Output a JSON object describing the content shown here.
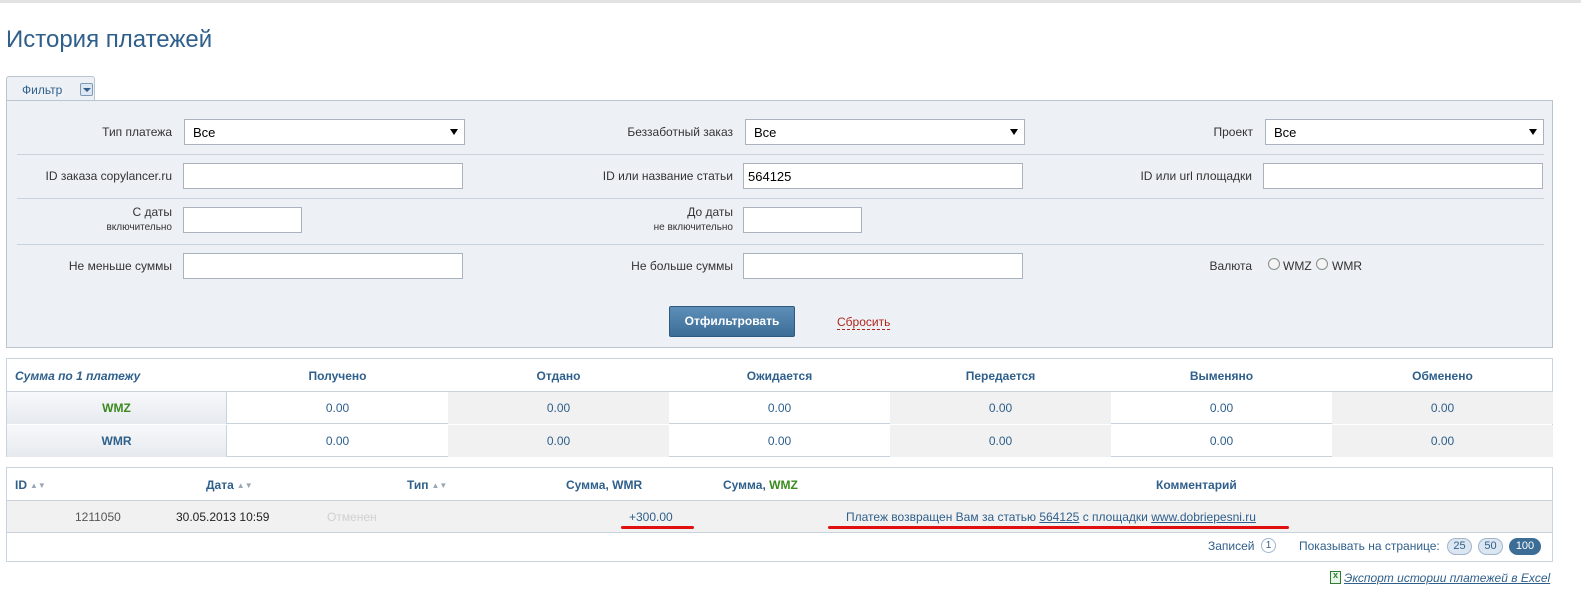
{
  "page": {
    "title": "История платежей"
  },
  "filter": {
    "tab_label": "Фильтр",
    "payment_type": {
      "label": "Тип платежа",
      "value": "Все"
    },
    "carefree_order": {
      "label": "Беззаботный заказ",
      "value": "Все"
    },
    "project": {
      "label": "Проект",
      "value": "Все"
    },
    "order_id": {
      "label": "ID заказа copylancer.ru",
      "value": ""
    },
    "article": {
      "label": "ID или название статьи",
      "value": "564125"
    },
    "site": {
      "label": "ID или url площадки",
      "value": ""
    },
    "date_from": {
      "label": "С даты",
      "sublabel": "включительно",
      "value": ""
    },
    "date_to": {
      "label": "До даты",
      "sublabel": "не включительно",
      "value": ""
    },
    "min_sum": {
      "label": "Не меньше суммы",
      "value": ""
    },
    "max_sum": {
      "label": "Не больше суммы",
      "value": ""
    },
    "currency": {
      "label": "Валюта",
      "options": [
        "WMZ",
        "WMR"
      ]
    },
    "submit_label": "Отфильтровать",
    "reset_label": "Сбросить"
  },
  "summary": {
    "headers": [
      "Сумма по 1 платежу",
      "Получено",
      "Отдано",
      "Ожидается",
      "Передается",
      "Выменяно",
      "Обменено"
    ],
    "rows": [
      {
        "label": "WMZ",
        "values": [
          "0.00",
          "0.00",
          "0.00",
          "0.00",
          "0.00",
          "0.00"
        ]
      },
      {
        "label": "WMR",
        "values": [
          "0.00",
          "0.00",
          "0.00",
          "0.00",
          "0.00",
          "0.00"
        ]
      }
    ]
  },
  "payments": {
    "headers": {
      "id": "ID",
      "date": "Дата",
      "type": "Тип",
      "sum_wmr": "Сумма, WMR",
      "sum_wmz_prefix": "Сумма,",
      "sum_wmz_currency": "WMZ",
      "comment": "Комментарий"
    },
    "rows": [
      {
        "id": "1211050",
        "date": "30.05.2013 10:59",
        "type": "Отменен",
        "sum_wmr": "+300.00",
        "sum_wmz": "",
        "comment_pre": "Платеж возвращен Вам за статью",
        "comment_article": "564125",
        "comment_mid": "с площадки",
        "comment_site": "www.dobriepesni.ru"
      }
    ],
    "records_label": "Записей",
    "records_count": "1",
    "per_page_label": "Показывать на странице:",
    "per_page_options": [
      "25",
      "50",
      "100"
    ],
    "per_page_selected": "100"
  },
  "export_label": "Экспорт истории платежей в Excel",
  "colors": {
    "accent": "#2f5f8b",
    "wmz_green": "#3a8a1e",
    "annotation_red": "#e01010"
  }
}
